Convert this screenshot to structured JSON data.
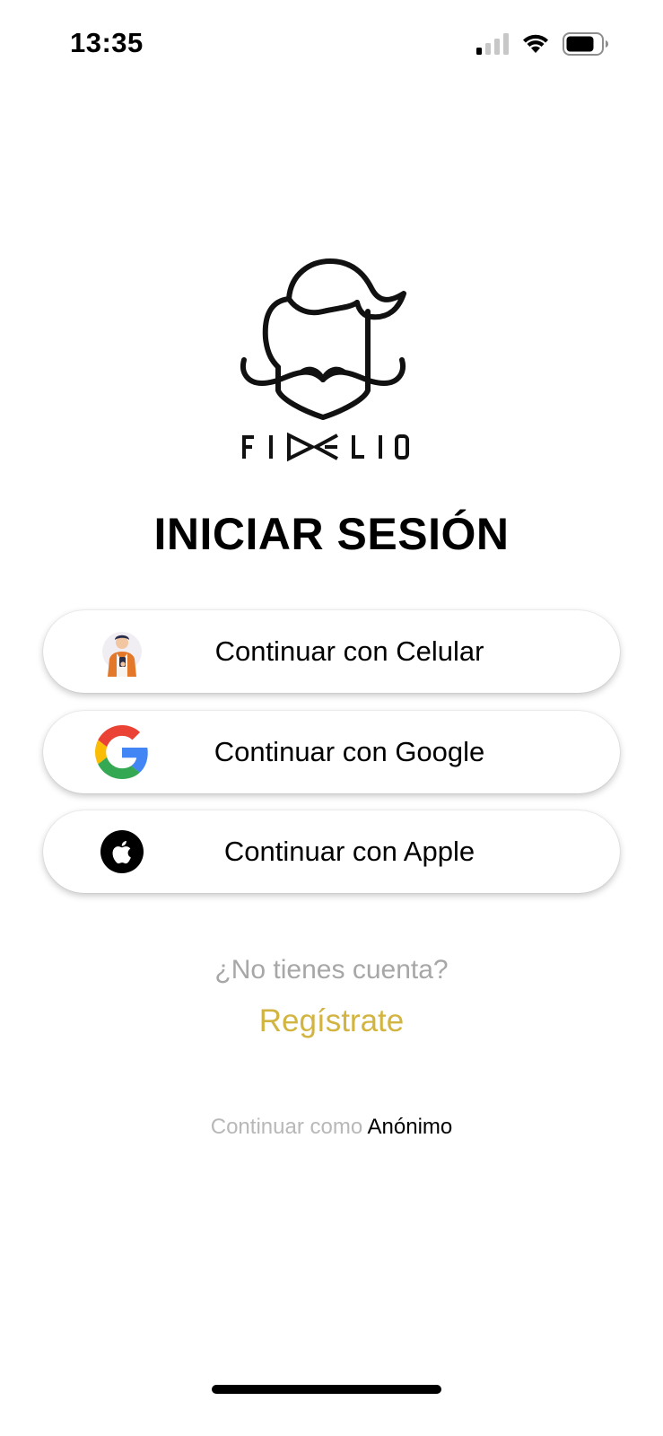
{
  "status_bar": {
    "time": "13:35",
    "icons": [
      "cellular-signal-icon",
      "wifi-icon",
      "battery-icon"
    ]
  },
  "brand": {
    "logo_text": "FIDELIO",
    "logo_icon": "mustache-face-logo"
  },
  "title": "INICIAR SESIÓN",
  "login_buttons": [
    {
      "label": "Continuar con Celular",
      "icon": "person-with-phone-icon"
    },
    {
      "label": "Continuar con Google",
      "icon": "google-icon"
    },
    {
      "label": "Continuar con Apple",
      "icon": "apple-icon"
    }
  ],
  "signup": {
    "prompt": "¿No tienes cuenta?",
    "link": "Regístrate"
  },
  "anonymous": {
    "prefix": "Continuar como",
    "link": "Anónimo"
  },
  "colors": {
    "accent_gold": "#d2b440",
    "muted_text": "#a7a7a7",
    "google_blue": "#4285F4",
    "google_red": "#EA4335",
    "google_yellow": "#FBBC05",
    "google_green": "#34A853"
  }
}
